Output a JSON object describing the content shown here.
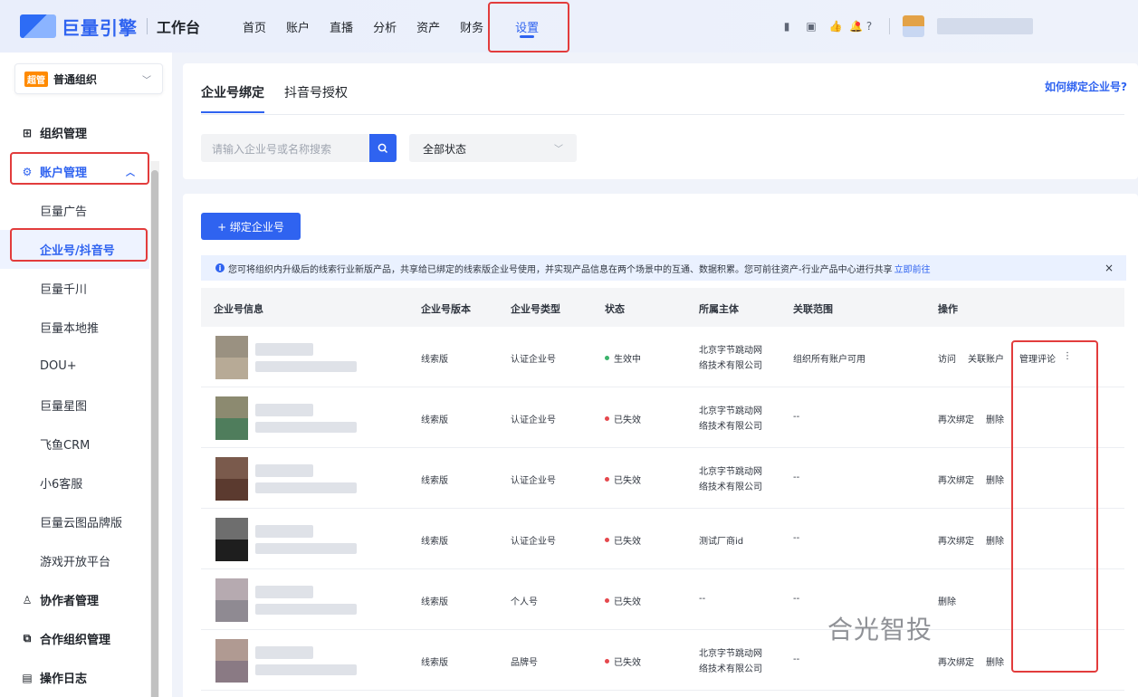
{
  "header": {
    "brand": "巨量引擎",
    "workspace": "工作台",
    "nav": [
      {
        "label": "首页"
      },
      {
        "label": "账户"
      },
      {
        "label": "直播"
      },
      {
        "label": "分析"
      },
      {
        "label": "资产"
      },
      {
        "label": "财务"
      },
      {
        "label": "设置",
        "active": true
      }
    ],
    "icons": [
      "phone-icon",
      "clipboard-icon",
      "thumbs-up-icon",
      "bell-icon",
      "help-icon"
    ]
  },
  "sidebar": {
    "org": {
      "badge": "超管",
      "name": "普通组织"
    },
    "items": [
      {
        "label": "组织管理",
        "icon": "grid-icon"
      },
      {
        "label": "账户管理",
        "icon": "gear-icon"
      },
      {
        "label": "巨量广告"
      },
      {
        "label": "企业号/抖音号"
      },
      {
        "label": "巨量千川"
      },
      {
        "label": "巨量本地推"
      },
      {
        "label": "DOU+"
      },
      {
        "label": "巨量星图"
      },
      {
        "label": "飞鱼CRM"
      },
      {
        "label": "小6客服"
      },
      {
        "label": "巨量云图品牌版"
      },
      {
        "label": "游戏开放平台"
      },
      {
        "label": "协作者管理",
        "icon": "people-icon"
      },
      {
        "label": "合作组织管理",
        "icon": "org-icon"
      },
      {
        "label": "操作日志",
        "icon": "log-icon"
      }
    ]
  },
  "main": {
    "tabs": [
      {
        "label": "企业号绑定"
      },
      {
        "label": "抖音号授权"
      }
    ],
    "howto": "如何绑定企业号?",
    "search_placeholder": "请输入企业号或名称搜索",
    "status_filter": "全部状态",
    "add_button": "+ 绑定企业号",
    "notice": {
      "text": "您可将组织内升级后的线索行业新版产品，共享给已绑定的线索版企业号使用，并实现产品信息在两个场景中的互通、数据积累。您可前往资产-行业产品中心进行共享",
      "link": "立即前往",
      "close": "×"
    },
    "table": {
      "headers": [
        "企业号信息",
        "企业号版本",
        "企业号类型",
        "状态",
        "所属主体",
        "关联范围",
        "操作"
      ],
      "rows": [
        {
          "version": "线索版",
          "type": "认证企业号",
          "status": "生效中",
          "owner": [
            "北京字节跳动网",
            "络技术有限公司"
          ],
          "scope": "组织所有账户可用",
          "ops": [
            "访问",
            "关联账户",
            "管理评论",
            "⋮"
          ]
        },
        {
          "version": "线索版",
          "type": "认证企业号",
          "status": "已失效",
          "owner": [
            "北京字节跳动网",
            "络技术有限公司"
          ],
          "scope": "--",
          "ops": [
            "再次绑定",
            "删除"
          ]
        },
        {
          "version": "线索版",
          "type": "认证企业号",
          "status": "已失效",
          "owner": [
            "北京字节跳动网",
            "络技术有限公司"
          ],
          "scope": "--",
          "ops": [
            "再次绑定",
            "删除"
          ]
        },
        {
          "version": "线索版",
          "type": "认证企业号",
          "status": "已失效",
          "owner": [
            "测试厂商id"
          ],
          "scope": "--",
          "ops": [
            "再次绑定",
            "删除"
          ]
        },
        {
          "version": "线索版",
          "type": "个人号",
          "status": "已失效",
          "owner": [
            "--"
          ],
          "scope": "--",
          "ops": [
            "删除"
          ]
        },
        {
          "version": "线索版",
          "type": "品牌号",
          "status": "已失效",
          "owner": [
            "北京字节跳动网",
            "络技术有限公司"
          ],
          "scope": "--",
          "ops": [
            "再次绑定",
            "删除"
          ]
        }
      ]
    }
  },
  "watermark": "合光智投",
  "colors": {
    "accent": "#2f63f0",
    "active_status": "#3bb36b",
    "inactive_status": "#e5484d",
    "highlight_box": "#e23c3c"
  }
}
